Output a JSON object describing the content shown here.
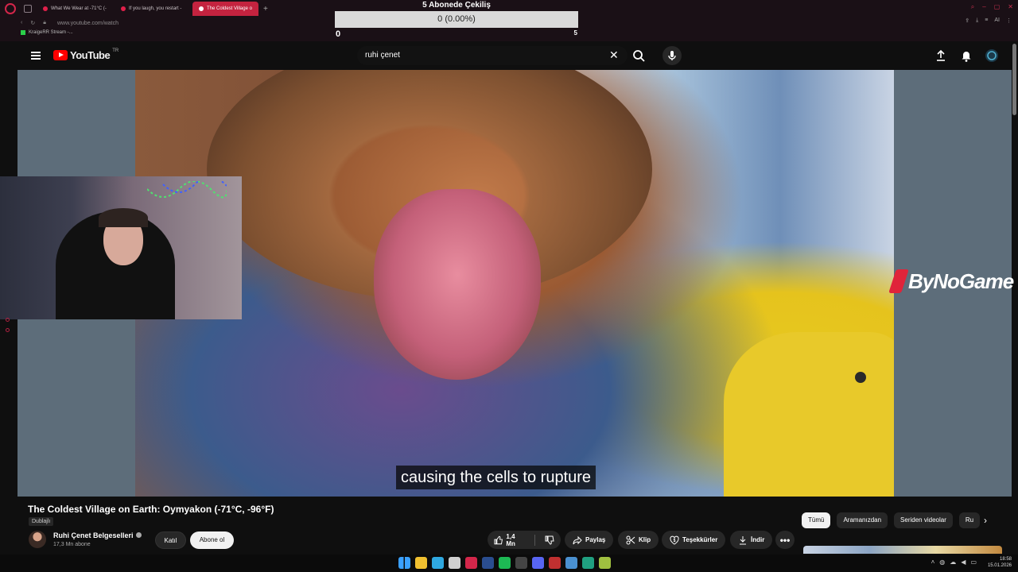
{
  "browser": {
    "tabs": [
      {
        "label": "What We Wear at -71°C (-",
        "active": false
      },
      {
        "label": "If you laugh, you restart -",
        "active": false
      },
      {
        "label": "The Coldest Village o",
        "active": true
      }
    ],
    "new_tab": "+",
    "url": "www.youtube.com/watch",
    "bookmark": "KraigeRR Stream -...",
    "account_label": "AI",
    "win_controls": [
      "–",
      "▢",
      "✕"
    ]
  },
  "poll": {
    "title": "5 Abonede Çekiliş",
    "progress_text": "0 (0.00%)",
    "progress_fraction": 0,
    "min": "0",
    "max": "5"
  },
  "youtube": {
    "logo_text": "YouTube",
    "region": "TR",
    "search_value": "ruhi çenet",
    "icons": [
      "menu-icon",
      "search-icon",
      "mic-icon",
      "upload-icon",
      "bell-icon",
      "avatar-icon"
    ]
  },
  "video": {
    "subtitle": "causing the cells to rupture",
    "watermark": "ByNoGame",
    "title": "The Coldest Village on Earth: Oymyakon (-71°C, -96°F)",
    "badge": "Dublajlı"
  },
  "channel": {
    "name": "Ruhi Çenet Belgeselleri",
    "subscribers": "17,3 Mn abone",
    "join_label": "Katıl",
    "subscribe_label": "Abone ol"
  },
  "actions": {
    "likes": "1,4 Mn",
    "share": "Paylaş",
    "clip": "Klip",
    "thanks": "Teşekkürler",
    "download": "İndir",
    "more": "•••"
  },
  "chips": [
    "Tümü",
    "Aramanızdan",
    "Seriden videolar",
    "Ru"
  ],
  "chip_arrow": "›",
  "taskbar": {
    "time": "18:58",
    "date": "15.01.2026",
    "apps": [
      "windows",
      "file-explorer",
      "edge",
      "store",
      "opera",
      "steam",
      "spotify",
      "terminal",
      "discord",
      "media",
      "photos",
      "app",
      "app2"
    ],
    "colors": [
      "#3aa0ff",
      "#f0c030",
      "#2fa8e0",
      "#cfcfcf",
      "#d3264a",
      "#2a4d8f",
      "#1db954",
      "#444444",
      "#5865f2",
      "#c03030",
      "#4a90d0",
      "#20a080",
      "#a0c040"
    ]
  }
}
